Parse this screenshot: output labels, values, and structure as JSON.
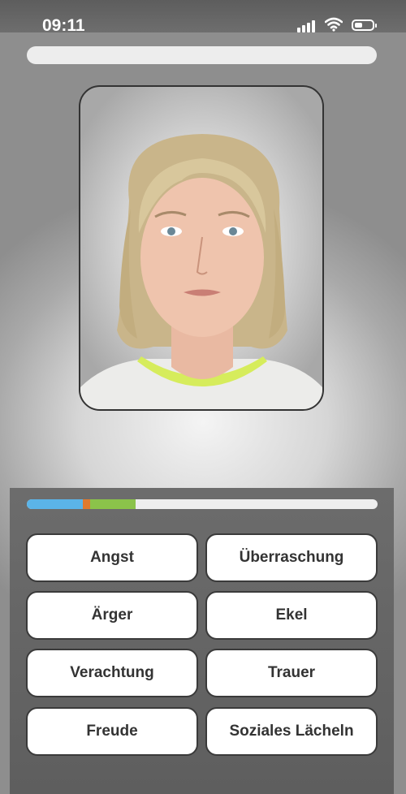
{
  "status_bar": {
    "time": "09:11",
    "battery_level": 0.3
  },
  "quiz": {
    "progress_total": 1.0
  },
  "colors": {
    "seg_blue": "#5bb4e8",
    "seg_orange": "#e07a2e",
    "seg_green": "#8bc34a",
    "shirt_collar": "#d6ec5c"
  },
  "answer_progress": [
    {
      "name": "blue",
      "fraction": 0.16
    },
    {
      "name": "orange",
      "fraction": 0.02
    },
    {
      "name": "green",
      "fraction": 0.13
    }
  ],
  "answers": {
    "angst": "Angst",
    "ueberraschung": "Überraschung",
    "aerger": "Ärger",
    "ekel": "Ekel",
    "verachtung": "Verachtung",
    "trauer": "Trauer",
    "freude": "Freude",
    "soziales_laecheln": "Soziales Lächeln"
  }
}
